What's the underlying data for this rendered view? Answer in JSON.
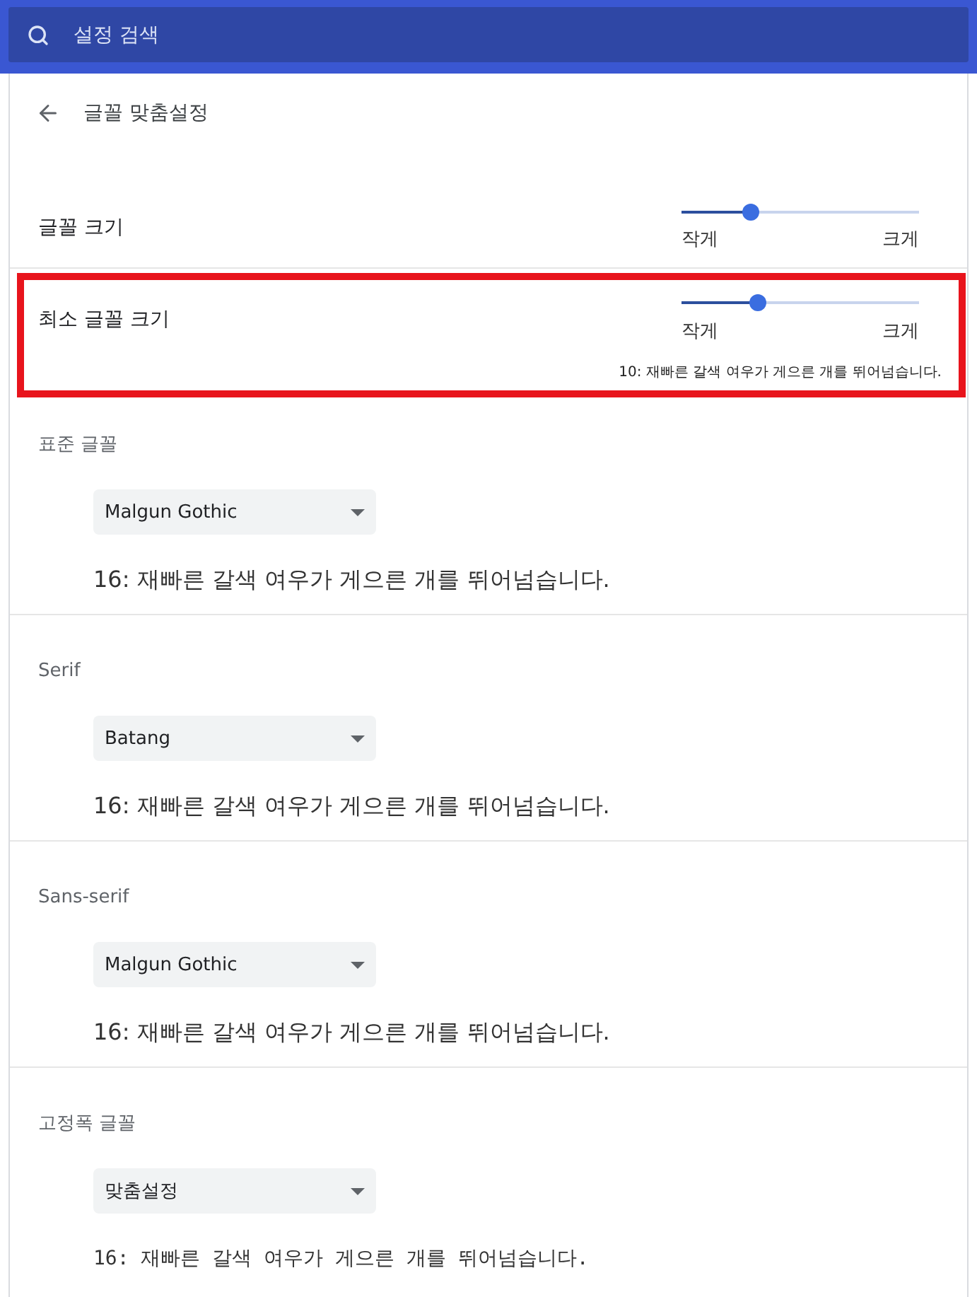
{
  "search": {
    "placeholder": "설정 검색"
  },
  "page": {
    "title": "글꼴 맞춤설정"
  },
  "size_settings": [
    {
      "label": "글꼴 크기",
      "level": 0.29,
      "min_label": "작게",
      "max_label": "크게",
      "highlighted": false
    },
    {
      "label": "최소 글꼴 크기",
      "level": 0.32,
      "min_label": "작게",
      "max_label": "크게",
      "sample": "10: 재빠른 갈색 여우가 게으른 개를 뛰어넘습니다.",
      "highlighted": true
    }
  ],
  "font_settings": [
    {
      "label": "표준 글꼴",
      "value": "Malgun Gothic",
      "sample": "16: 재빠른 갈색 여우가 게으른 개를 뛰어넘습니다.",
      "kind": "proportional"
    },
    {
      "label": "Serif",
      "value": "Batang",
      "sample": "16: 재빠른 갈색 여우가 게으른 개를 뛰어넘습니다.",
      "kind": "proportional"
    },
    {
      "label": "Sans-serif",
      "value": "Malgun Gothic",
      "sample": "16: 재빠른 갈색 여우가 게으른 개를 뛰어넘습니다.",
      "kind": "proportional"
    },
    {
      "label": "고정폭 글꼴",
      "value": "맞춤설정",
      "sample": "16: 재빠른 갈색 여우가 게으른 개를 뛰어넘습니다.",
      "kind": "monospace"
    }
  ]
}
